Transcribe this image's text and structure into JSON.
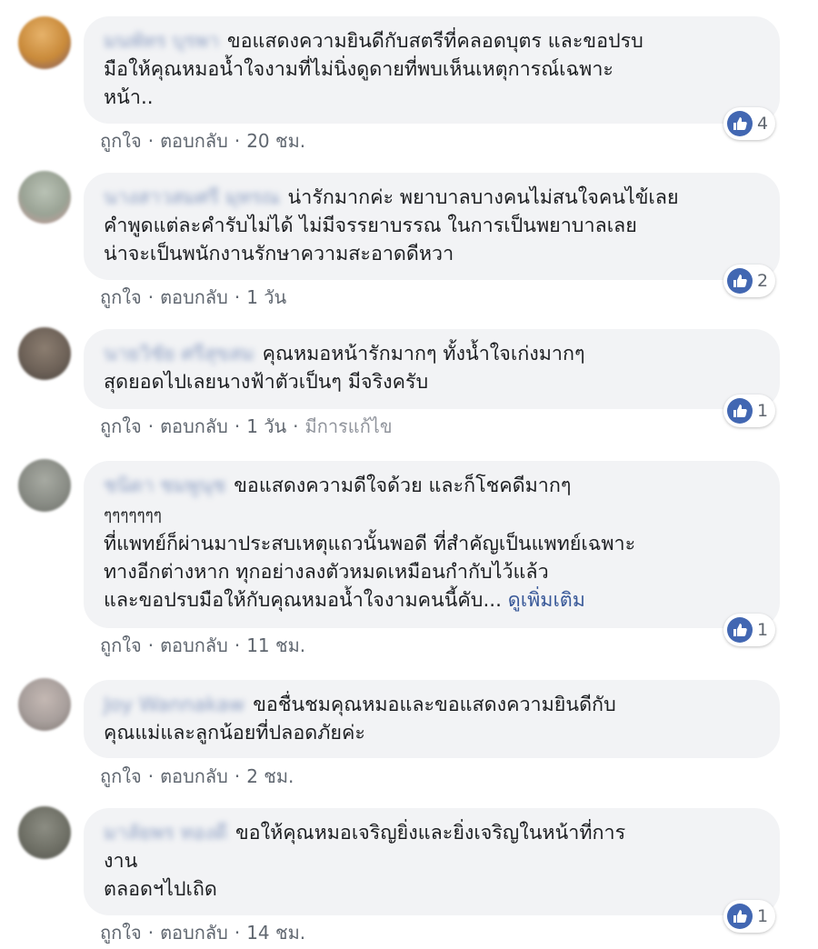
{
  "labels": {
    "like": "ถูกใจ",
    "reply": "ตอบกลับ",
    "separator": "·"
  },
  "colors": {
    "link": "#385898",
    "bubble": "#f2f3f5",
    "like_badge": "#4267b2",
    "meta": "#606770"
  },
  "comments": [
    {
      "author": "มนพัทร บุรพา",
      "text": "ขอแสดงความยินดีกับสตรีที่คลอดบุตร และขอปรบ\nมือให้คุณหมอน้ำใจงามที่ไม่นิ่งดูดายที่พบเห็นเหตุการณ์เฉพาะ\nหน้า..",
      "time": "20 ชม.",
      "likes": "4",
      "avatar_color": "#c98a3a"
    },
    {
      "author": "นางสาวสมศรี มุทรณ",
      "text": "น่ารักมากค่ะ พยาบาลบางคนไม่สนใจคนไข้เลย\nคำพูดแต่ละคำรับไม่ได้ ไม่มีจรรยาบรรณ ในการเป็นพยาบาลเลย\nน่าจะเป็นพนักงานรักษาความสะอาดดีหวา",
      "time": "1 วัน",
      "likes": "2",
      "avatar_color": "#9aa395"
    },
    {
      "author": "นายวิชัย ศรีสุขสม",
      "text": "คุณหมอหน้ารักมากๆ ทั้งน้ำใจเก่งมากๆ\nสุดยอดไปเลยนางฟ้าตัวเป็นๆ มีจริงครับ",
      "time": "1 วัน",
      "edited": "มีการแก้ไข",
      "likes": "1",
      "avatar_color": "#6e6258"
    },
    {
      "author": "ชนิดา ชมพูนุช",
      "text_first": "ขอแสดงความดีใจด้วย และก็โชคดีมากๆ",
      "text_small": "ๆๆๆๆๆๆๆ",
      "text_rest": "ที่แพทย์ก็ผ่านมาประสบเหตุแถวนั้นพอดี ที่สำคัญเป็นแพทย์เฉพาะ\nทางอีกต่างหาก ทุกอย่างลงตัวหมดเหมือนกำกับไว้แล้ว\nและขอปรบมือให้กับคุณหมอน้ำใจงามคนนี้คับ... ",
      "see_more": "ดูเพิ่มเติม",
      "time": "11 ชม.",
      "likes": "1",
      "avatar_color": "#8a8d86"
    },
    {
      "author": "Joy Wannakaw",
      "text": "ขอชื่นชมคุณหมอและขอแสดงความยินดีกับ\nคุณแม่และลูกน้อยที่ปลอดภัยค่ะ",
      "time": "2 ชม.",
      "likes": null,
      "avatar_color": "#a89f9c"
    },
    {
      "author": "มาลัยพร ทองดี",
      "text": "ขอให้คุณหมอเจริญยิ่งและยิ่งเจริญในหน้าที่การ\nงาน\nตลอดฯไปเถิด",
      "time": "14 ชม.",
      "likes": "1",
      "avatar_color": "#6f7066"
    }
  ]
}
